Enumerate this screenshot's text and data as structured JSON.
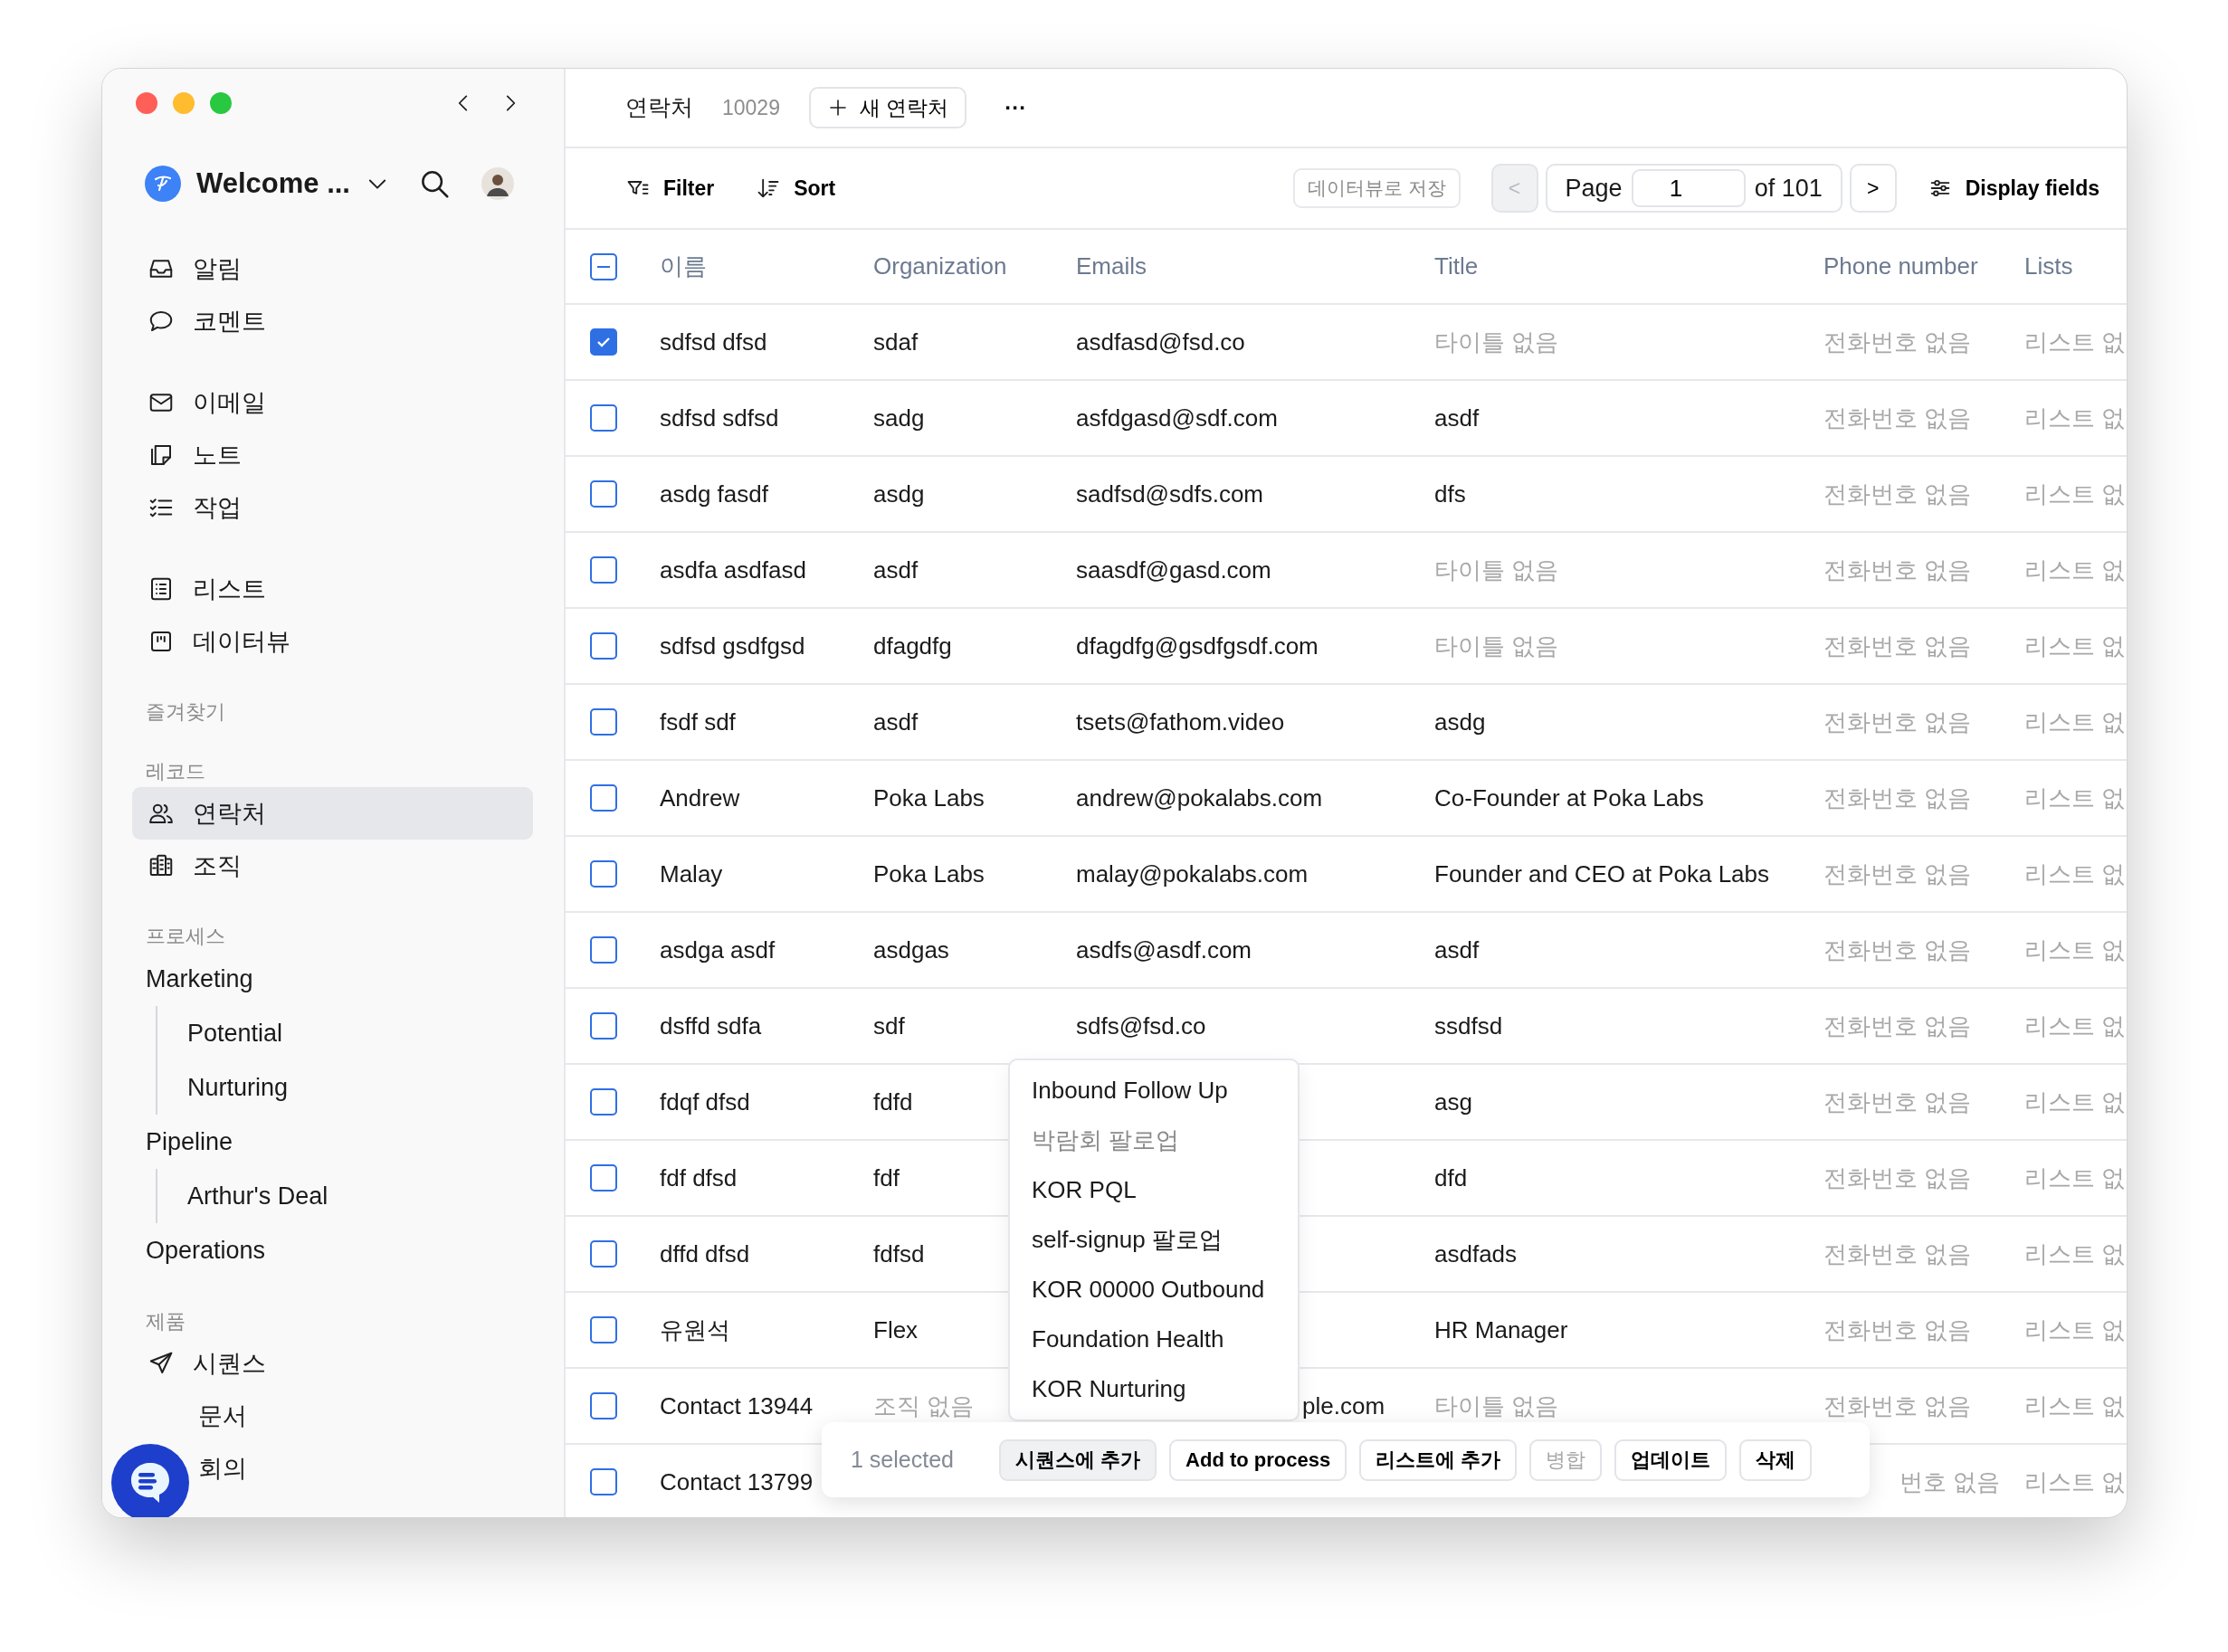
{
  "sidebar": {
    "workspace": "Welcome ...",
    "nav_groups": [
      [
        {
          "label": "알림",
          "selected": false
        },
        {
          "label": "코멘트",
          "selected": false
        }
      ],
      [
        {
          "label": "이메일",
          "selected": false
        },
        {
          "label": "노트",
          "selected": false
        },
        {
          "label": "작업",
          "selected": false
        }
      ],
      [
        {
          "label": "리스트",
          "selected": false
        },
        {
          "label": "데이터뷰",
          "selected": false
        }
      ]
    ],
    "sections": [
      {
        "title": "즐겨찾기"
      },
      {
        "title": "레코드",
        "items": [
          {
            "label": "연락처",
            "selected": true
          },
          {
            "label": "조직",
            "selected": false
          }
        ]
      },
      {
        "title": "프로세스",
        "tree": [
          {
            "label": "Marketing",
            "selected": false,
            "children": [
              {
                "label": "Potential",
                "selected": false
              },
              {
                "label": "Nurturing",
                "selected": false
              }
            ]
          },
          {
            "label": "Pipeline",
            "selected": false,
            "children": [
              {
                "label": "Arthur's Deal",
                "selected": false
              }
            ]
          },
          {
            "label": "Operations",
            "selected": false
          }
        ]
      },
      {
        "title": "제품",
        "items": [
          {
            "label": "시퀀스",
            "selected": false
          },
          {
            "label": "문서",
            "selected": false
          },
          {
            "label": "회의",
            "selected": false
          }
        ]
      }
    ]
  },
  "header": {
    "title": "연락처",
    "count": "10029",
    "new_button": "새 연락처",
    "more": "···"
  },
  "toolbar": {
    "filter": "Filter",
    "sort": "Sort",
    "save_view": "데이터뷰로 저장",
    "prev": "<",
    "prev_disabled": true,
    "page_label": "Page",
    "page_value": "1",
    "page_total": "of 101",
    "next": ">",
    "next_disabled": false,
    "display_fields": "Display fields"
  },
  "table": {
    "select_all_indeterminate": true,
    "columns": [
      "이름",
      "Organization",
      "Emails",
      "Title",
      "Phone number",
      "Lists"
    ],
    "rows": [
      {
        "checked": true,
        "cells": [
          {
            "text": "sdfsd dfsd",
            "muted": false
          },
          {
            "text": "sdaf",
            "muted": false
          },
          {
            "text": "asdfasd@fsd.co",
            "muted": false
          },
          {
            "text": "타이틀 없음",
            "muted": true
          },
          {
            "text": "전화번호 없음",
            "muted": true
          },
          {
            "text": "리스트 없",
            "muted": true
          }
        ]
      },
      {
        "checked": false,
        "cells": [
          {
            "text": "sdfsd sdfsd",
            "muted": false
          },
          {
            "text": "sadg",
            "muted": false
          },
          {
            "text": "asfdgasd@sdf.com",
            "muted": false
          },
          {
            "text": "asdf",
            "muted": false
          },
          {
            "text": "전화번호 없음",
            "muted": true
          },
          {
            "text": "리스트 없",
            "muted": true
          }
        ]
      },
      {
        "checked": false,
        "cells": [
          {
            "text": "asdg fasdf",
            "muted": false
          },
          {
            "text": "asdg",
            "muted": false
          },
          {
            "text": "sadfsd@sdfs.com",
            "muted": false
          },
          {
            "text": "dfs",
            "muted": false
          },
          {
            "text": "전화번호 없음",
            "muted": true
          },
          {
            "text": "리스트 없",
            "muted": true
          }
        ]
      },
      {
        "checked": false,
        "cells": [
          {
            "text": "asdfa asdfasd",
            "muted": false
          },
          {
            "text": "asdf",
            "muted": false
          },
          {
            "text": "saasdf@gasd.com",
            "muted": false
          },
          {
            "text": "타이틀 없음",
            "muted": true
          },
          {
            "text": "전화번호 없음",
            "muted": true
          },
          {
            "text": "리스트 없",
            "muted": true
          }
        ]
      },
      {
        "checked": false,
        "cells": [
          {
            "text": "sdfsd gsdfgsd",
            "muted": false
          },
          {
            "text": "dfagdfg",
            "muted": false
          },
          {
            "text": "dfagdfg@gsdfgsdf.com",
            "muted": false
          },
          {
            "text": "타이틀 없음",
            "muted": true
          },
          {
            "text": "전화번호 없음",
            "muted": true
          },
          {
            "text": "리스트 없",
            "muted": true
          }
        ]
      },
      {
        "checked": false,
        "cells": [
          {
            "text": "fsdf sdf",
            "muted": false
          },
          {
            "text": "asdf",
            "muted": false
          },
          {
            "text": "tsets@fathom.video",
            "muted": false
          },
          {
            "text": "asdg",
            "muted": false
          },
          {
            "text": "전화번호 없음",
            "muted": true
          },
          {
            "text": "리스트 없",
            "muted": true
          }
        ]
      },
      {
        "checked": false,
        "cells": [
          {
            "text": "Andrew",
            "muted": false
          },
          {
            "text": "Poka Labs",
            "muted": false
          },
          {
            "text": "andrew@pokalabs.com",
            "muted": false
          },
          {
            "text": "Co-Founder at Poka Labs",
            "muted": false
          },
          {
            "text": "전화번호 없음",
            "muted": true
          },
          {
            "text": "리스트 없",
            "muted": true
          }
        ]
      },
      {
        "checked": false,
        "cells": [
          {
            "text": "Malay",
            "muted": false
          },
          {
            "text": "Poka Labs",
            "muted": false
          },
          {
            "text": "malay@pokalabs.com",
            "muted": false
          },
          {
            "text": "Founder and CEO at Poka Labs",
            "muted": false
          },
          {
            "text": "전화번호 없음",
            "muted": true
          },
          {
            "text": "리스트 없",
            "muted": true
          }
        ]
      },
      {
        "checked": false,
        "cells": [
          {
            "text": "asdga asdf",
            "muted": false
          },
          {
            "text": "asdgas",
            "muted": false
          },
          {
            "text": "asdfs@asdf.com",
            "muted": false
          },
          {
            "text": "asdf",
            "muted": false
          },
          {
            "text": "전화번호 없음",
            "muted": true
          },
          {
            "text": "리스트 없",
            "muted": true
          }
        ]
      },
      {
        "checked": false,
        "cells": [
          {
            "text": "dsffd sdfa",
            "muted": false
          },
          {
            "text": "sdf",
            "muted": false
          },
          {
            "text": "sdfs@fsd.co",
            "muted": false
          },
          {
            "text": "ssdfsd",
            "muted": false
          },
          {
            "text": "전화번호 없음",
            "muted": true
          },
          {
            "text": "리스트 없",
            "muted": true
          }
        ]
      },
      {
        "checked": false,
        "cells": [
          {
            "text": "fdqf dfsd",
            "muted": false
          },
          {
            "text": "fdfd",
            "muted": false
          },
          null,
          {
            "text": "asg",
            "muted": false
          },
          {
            "text": "전화번호 없음",
            "muted": true
          },
          {
            "text": "리스트 없",
            "muted": true
          }
        ]
      },
      {
        "checked": false,
        "cells": [
          {
            "text": "fdf dfsd",
            "muted": false
          },
          {
            "text": "fdf",
            "muted": false
          },
          null,
          {
            "text": "dfd",
            "muted": false
          },
          {
            "text": "전화번호 없음",
            "muted": true
          },
          {
            "text": "리스트 없",
            "muted": true
          }
        ]
      },
      {
        "checked": false,
        "cells": [
          {
            "text": "dffd dfsd",
            "muted": false
          },
          {
            "text": "fdfsd",
            "muted": false
          },
          null,
          {
            "text": "asdfads",
            "muted": false
          },
          {
            "text": "전화번호 없음",
            "muted": true
          },
          {
            "text": "리스트 없",
            "muted": true
          }
        ]
      },
      {
        "checked": false,
        "cells": [
          {
            "text": "유원석",
            "muted": false
          },
          {
            "text": "Flex",
            "muted": false
          },
          null,
          {
            "text": "HR Manager",
            "muted": false
          },
          {
            "text": "전화번호 없음",
            "muted": true
          },
          {
            "text": "리스트 없",
            "muted": true
          }
        ]
      },
      {
        "checked": false,
        "cells": [
          {
            "text": "Contact 13944",
            "muted": false
          },
          {
            "text": "조직 없음",
            "muted": true
          },
          {
            "text": "ple.com",
            "muted": false,
            "covered": true
          },
          {
            "text": "타이틀 없음",
            "muted": true
          },
          {
            "text": "전화번호 없음",
            "muted": true
          },
          {
            "text": "리스트 없",
            "muted": true
          }
        ]
      },
      {
        "checked": false,
        "cells": [
          {
            "text": "Contact 13799",
            "muted": false
          },
          null,
          null,
          null,
          {
            "text": "번호 없음",
            "muted": true,
            "covered": true
          },
          {
            "text": "리스트 없",
            "muted": true
          }
        ]
      }
    ]
  },
  "dropdown": {
    "items": [
      {
        "label": "Inbound Follow Up",
        "disabled": false
      },
      {
        "label": "박람회 팔로업",
        "disabled": true
      },
      {
        "label": "KOR PQL",
        "disabled": false
      },
      {
        "label": "self-signup 팔로업",
        "disabled": false
      },
      {
        "label": "KOR 00000 Outbound",
        "disabled": false
      },
      {
        "label": "Foundation Health",
        "disabled": false
      },
      {
        "label": "KOR Nurturing",
        "disabled": false
      }
    ]
  },
  "action_bar": {
    "selection": "1 selected",
    "buttons": [
      {
        "label": "시퀀스에 추가",
        "selected": true,
        "disabled": false
      },
      {
        "label": "Add to process",
        "selected": false,
        "disabled": false
      },
      {
        "label": "리스트에 추가",
        "selected": false,
        "disabled": false
      },
      {
        "label": "병합",
        "selected": false,
        "disabled": true
      },
      {
        "label": "업데이트",
        "selected": false,
        "disabled": false
      },
      {
        "label": "삭제",
        "selected": false,
        "disabled": false
      }
    ]
  }
}
